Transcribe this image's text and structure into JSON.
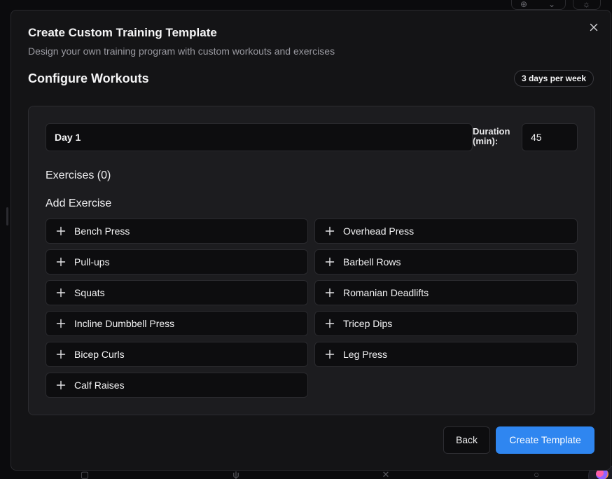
{
  "modal": {
    "title": "Create Custom Training Template",
    "subtitle": "Design your own training program with custom workouts and exercises",
    "close_icon": "close-icon"
  },
  "configure": {
    "title": "Configure Workouts",
    "frequency_badge": "3 days per week"
  },
  "workout": {
    "day_name": "Day 1",
    "duration_label": "Duration (min):",
    "duration_value": "45",
    "exercises_heading": "Exercises (0)",
    "add_exercise_heading": "Add Exercise",
    "exercise_options": [
      {
        "label": "Bench Press",
        "icon": "plus-icon"
      },
      {
        "label": "Overhead Press",
        "icon": "plus-icon"
      },
      {
        "label": "Pull-ups",
        "icon": "plus-icon"
      },
      {
        "label": "Barbell Rows",
        "icon": "plus-icon"
      },
      {
        "label": "Squats",
        "icon": "plus-icon"
      },
      {
        "label": "Romanian Deadlifts",
        "icon": "plus-icon"
      },
      {
        "label": "Incline Dumbbell Press",
        "icon": "plus-icon"
      },
      {
        "label": "Tricep Dips",
        "icon": "plus-icon"
      },
      {
        "label": "Bicep Curls",
        "icon": "plus-icon"
      },
      {
        "label": "Leg Press",
        "icon": "plus-icon"
      },
      {
        "label": "Calf Raises",
        "icon": "plus-icon"
      }
    ]
  },
  "footer": {
    "back_label": "Back",
    "create_label": "Create Template"
  },
  "colors": {
    "primary": "#2f86f0",
    "background": "#141416",
    "card": "#1c1c1f"
  }
}
